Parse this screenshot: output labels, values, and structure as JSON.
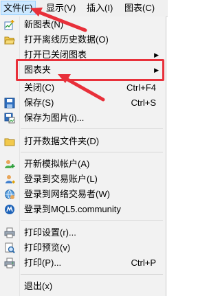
{
  "menubar": {
    "items": [
      {
        "label": "文件(F)"
      },
      {
        "label": "显示(V)"
      },
      {
        "label": "插入(I)"
      },
      {
        "label": "图表(C)"
      }
    ]
  },
  "file_menu": {
    "items": [
      {
        "label": "新图表(N)",
        "icon": "new-chart-icon"
      },
      {
        "label": "打开离线历史数据(O)",
        "icon": "open-folder-icon"
      },
      {
        "label": "打开已关闭图表",
        "has_submenu": true
      },
      {
        "label": "图表夹",
        "has_submenu": true,
        "highlighted": true
      },
      {
        "label": "关闭(C)",
        "shortcut": "Ctrl+F4"
      },
      {
        "label": "保存(S)",
        "shortcut": "Ctrl+S",
        "icon": "save-icon"
      },
      {
        "label": "保存为图片(i)...",
        "icon": "save-image-icon"
      },
      {
        "label": "打开数据文件夹(D)",
        "icon": "folder-icon"
      },
      {
        "label": "开新模拟帐户(A)",
        "icon": "add-user-icon"
      },
      {
        "label": "登录到交易账户(L)",
        "icon": "login-user-icon"
      },
      {
        "label": "登录到网络交易者(W)",
        "icon": "network-trader-icon"
      },
      {
        "label": "登录到MQL5.community",
        "icon": "mql5-icon"
      },
      {
        "label": "打印设置(r)...",
        "icon": "print-setup-icon"
      },
      {
        "label": "打印预览(v)",
        "icon": "print-preview-icon"
      },
      {
        "label": "打印(P)...",
        "shortcut": "Ctrl+P",
        "icon": "printer-icon"
      },
      {
        "label": "退出(x)"
      }
    ]
  },
  "colors": {
    "annotation": "#e8303a",
    "active_menu": "#cce8ff"
  }
}
